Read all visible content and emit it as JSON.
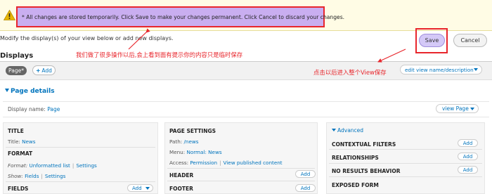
{
  "warning": {
    "message": "* All changes are stored temporarily. Click Save to make your changes permanent. Click Cancel to discard your changes."
  },
  "intro_text": "Modify the display(s) of your view below or add new displays.",
  "buttons": {
    "save": "Save",
    "cancel": "Cancel"
  },
  "annotations": {
    "note_1": "我们做了很多操作以后,会上看到面有提示你的内容只是临时保存",
    "note_2": "点击以后进入整个View保存"
  },
  "displays": {
    "title": "Displays",
    "tabs": [
      {
        "label": "Page*"
      }
    ],
    "add_label": "Add",
    "edit_name_label": "edit view name/description"
  },
  "page_details": {
    "heading": "Page details",
    "display_name_label": "Display name:",
    "display_name_value": "Page",
    "view_page_label": "view Page"
  },
  "col1": {
    "title_hdr": "TITLE",
    "title_label": "Title:",
    "title_value": "News",
    "format_hdr": "FORMAT",
    "format_label": "Format:",
    "format_value": "Unformatted list",
    "format_settings": "Settings",
    "show_label": "Show:",
    "show_value": "Fields",
    "show_settings": "Settings",
    "fields_hdr": "FIELDS",
    "fields_add": "Add"
  },
  "col2": {
    "page_settings_hdr": "PAGE SETTINGS",
    "path_label": "Path:",
    "path_value": "/news",
    "menu_label": "Menu:",
    "menu_value": "Normal: News",
    "access_label": "Access:",
    "access_value": "Permission",
    "view_published": "View published content",
    "header_hdr": "HEADER",
    "header_add": "Add",
    "footer_hdr": "FOOTER",
    "footer_add": "Add"
  },
  "col3": {
    "advanced_label": "Advanced",
    "contextual_filters": "CONTEXTUAL FILTERS",
    "relationships": "RELATIONSHIPS",
    "no_results": "NO RESULTS BEHAVIOR",
    "exposed_form": "EXPOSED FORM",
    "add": "Add"
  },
  "colors": {
    "annotation_red": "#e8262c",
    "link_blue": "#0074bd",
    "highlight_purple": "#c9aef0"
  }
}
